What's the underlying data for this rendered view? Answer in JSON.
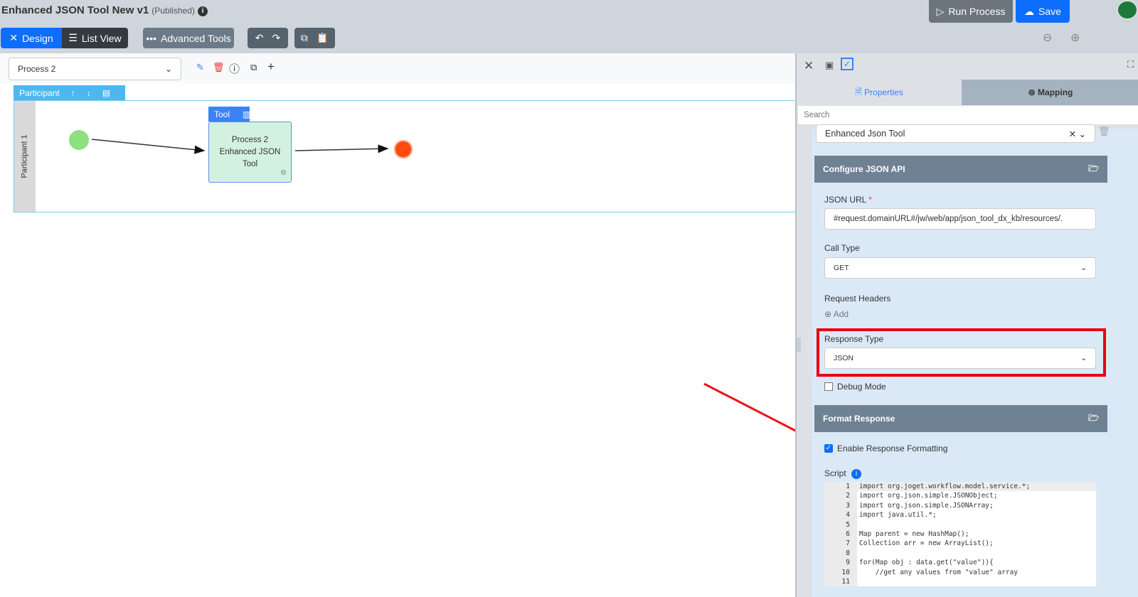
{
  "header": {
    "title": "Enhanced JSON Tool New v1",
    "status": "(Published)",
    "run_label": "Run Process",
    "save_label": "Save"
  },
  "toolbar": {
    "design": "Design",
    "list_view": "List View",
    "advanced_tools": "Advanced Tools"
  },
  "canvas": {
    "process_select": "Process 2",
    "participant_tab": "Participant",
    "lane_label": "Participant 1",
    "tool_tab": "Tool",
    "activity_label": "Process 2 Enhanced JSON Tool"
  },
  "panel": {
    "tabs": [
      "Properties",
      "Mapping"
    ],
    "search_placeholder": "Search",
    "plugin": "Enhanced Json Tool",
    "section1": "Configure JSON API",
    "json_url_label": "JSON URL",
    "required": "*",
    "json_url": "#request.domainURL#/jw/web/app/json_tool_dx_kb/resources/.",
    "call_type_label": "Call Type",
    "call_type": "GET",
    "headers_label": "Request Headers",
    "add_label": "Add",
    "response_type_label": "Response Type",
    "response_type": "JSON",
    "debug_label": "Debug Mode",
    "section2": "Format Response",
    "enable_formatting_label": "Enable Response Formatting",
    "script_label": "Script",
    "code_lines": [
      {
        "n": "1",
        "text": "import org.joget.workflow.model.service.*;"
      },
      {
        "n": "2",
        "text": "import org.json.simple.JSONObject;"
      },
      {
        "n": "3",
        "text": "import org.json.simple.JSONArray;"
      },
      {
        "n": "4",
        "text": "import java.util.*;"
      },
      {
        "n": "5",
        "text": ""
      },
      {
        "n": "6",
        "text": "Map parent = new HashMap();"
      },
      {
        "n": "7",
        "text": "Collection arr = new ArrayList();"
      },
      {
        "n": "8",
        "text": ""
      },
      {
        "n": "9",
        "text": "for(Map obj : data.get(\"value\")){"
      },
      {
        "n": "10",
        "text": "    //get any values from \"value\" array"
      },
      {
        "n": "11",
        "text": ""
      }
    ]
  },
  "colors": {
    "accent": "#0d6efd",
    "highlight": "#e8000b",
    "annotation_arrow": "#e8131b"
  }
}
